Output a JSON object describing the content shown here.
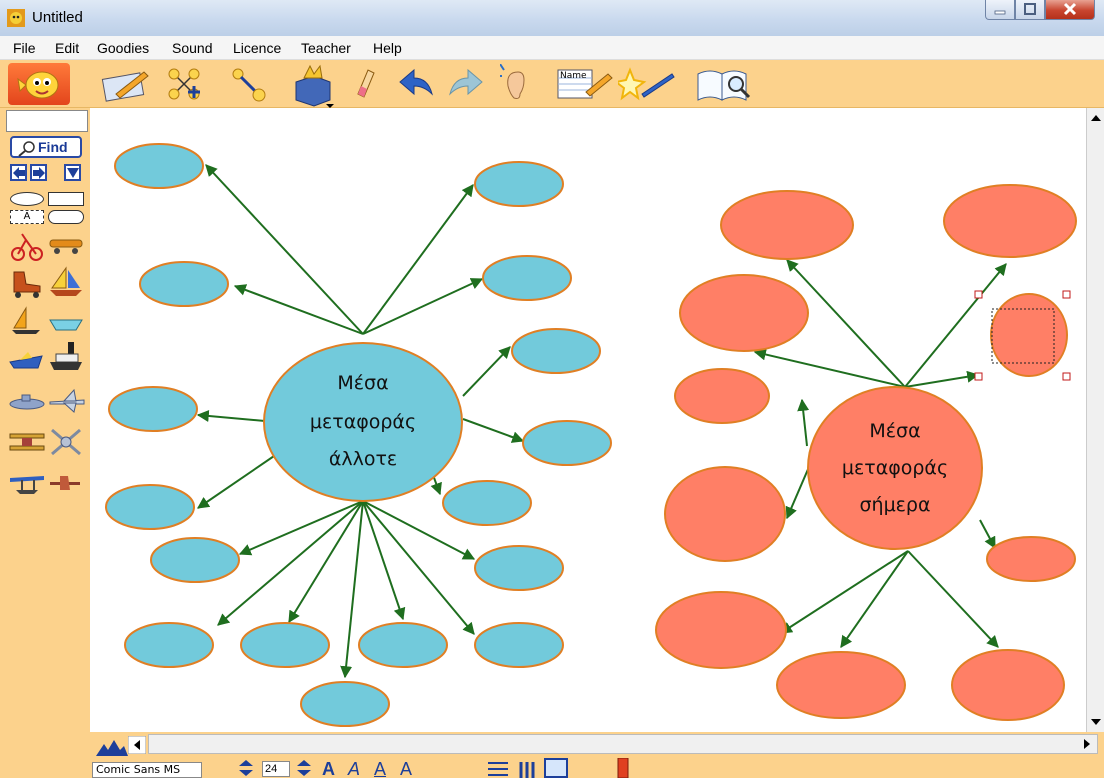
{
  "window": {
    "title": "Untitled"
  },
  "menu": [
    "File",
    "Edit",
    "Goodies",
    "Sound",
    "Licence",
    "Teacher",
    "Help"
  ],
  "toolbar": {
    "icons": [
      "mascot-icon",
      "picture-pencil-icon",
      "network-icon",
      "link-arrow-icon",
      "goodies-box-icon",
      "eraser-icon",
      "undo-icon",
      "redo-icon",
      "ear-icon",
      "name-tag-icon",
      "magic-wand-icon",
      "book-search-icon"
    ],
    "name_tag_text": "Name"
  },
  "sidebar": {
    "find_label": "Find",
    "shape_label": "A",
    "stamps": [
      "tricycle-icon",
      "skateboard-icon",
      "roller-skate-icon",
      "sailboat-icon",
      "sailboard-icon",
      "rowboat-icon",
      "speedboat-icon",
      "steamship-icon",
      "submarine-icon",
      "jet-icon",
      "biplane-icon",
      "helicopter-icon",
      "seaplane-icon",
      "propeller-plane-icon"
    ]
  },
  "map_left": {
    "center_label": [
      "Μέσα",
      "μεταφοράς",
      "άλλοτε"
    ],
    "fill": "#72cadb",
    "stroke": "#e07f24"
  },
  "map_right": {
    "center_label": [
      "Μέσα",
      "μεταφοράς",
      "σήμερα"
    ],
    "fill": "#ff7f66",
    "stroke": "#e07f24"
  },
  "arrow_color": "#1f6e1f",
  "bottom": {
    "font_name": "Comic Sans MS",
    "font_size": "24"
  }
}
